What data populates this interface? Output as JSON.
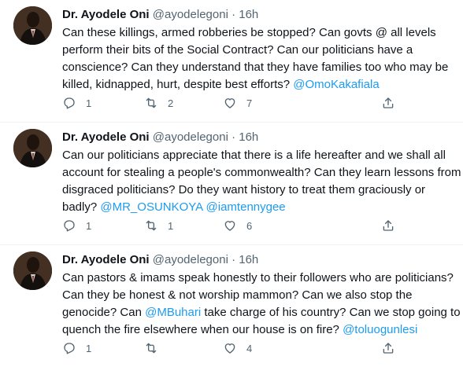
{
  "tweets": [
    {
      "author": "Dr. Ayodele Oni",
      "handle": "@ayodelegoni",
      "separator": "·",
      "time": "16h",
      "lines": [
        [
          {
            "t": "Can these killings, armed robberies be stopped? Can govts @ all levels"
          }
        ],
        [
          {
            "t": "perform their bits of the Social Contract? Can our politicians have a"
          }
        ],
        [
          {
            "t": "conscience? Can they understand that they have families too who may be"
          }
        ],
        [
          {
            "t": "killed, kidnapped, hurt, despite best efforts? "
          },
          {
            "t": "@OmoKakafiala",
            "link": true
          }
        ]
      ],
      "replies": "1",
      "retweets": "2",
      "likes": "7"
    },
    {
      "author": "Dr. Ayodele Oni",
      "handle": "@ayodelegoni",
      "separator": "·",
      "time": "16h",
      "lines": [
        [
          {
            "t": "Can our politicians appreciate that there is a life hereafter and we shall all"
          }
        ],
        [
          {
            "t": "account for stealing a people's commonwealth? Can they learn lessons from"
          }
        ],
        [
          {
            "t": "disgraced politicians? Do they want history to treat them graciously or"
          }
        ],
        [
          {
            "t": "badly? "
          },
          {
            "t": "@MR_OSUNKOYA",
            "link": true
          },
          {
            "t": " "
          },
          {
            "t": "@iamtennygee",
            "link": true
          }
        ]
      ],
      "replies": "1",
      "retweets": "1",
      "likes": "6"
    },
    {
      "author": "Dr. Ayodele Oni",
      "handle": "@ayodelegoni",
      "separator": "·",
      "time": "16h",
      "lines": [
        [
          {
            "t": "Can pastors & imams speak honestly to their followers who are politicians?"
          }
        ],
        [
          {
            "t": "Can they be honest & not worship mammon? Can we also stop the"
          }
        ],
        [
          {
            "t": "genocide? Can "
          },
          {
            "t": "@MBuhari",
            "link": true
          },
          {
            "t": " take charge of his country? Can we stop going to"
          }
        ],
        [
          {
            "t": "quench the fire elsewhere when our house is on fire? "
          },
          {
            "t": "@toluogunlesi",
            "link": true
          }
        ]
      ],
      "replies": "1",
      "retweets": "",
      "likes": "4"
    }
  ],
  "icons": {
    "reply": "reply-icon",
    "retweet": "retweet-icon",
    "like": "heart-icon",
    "share": "share-icon"
  },
  "colors": {
    "link": "#1d9bf0",
    "secondary_text": "#536471",
    "primary_text": "#0f1419",
    "divider": "#eff3f4"
  }
}
